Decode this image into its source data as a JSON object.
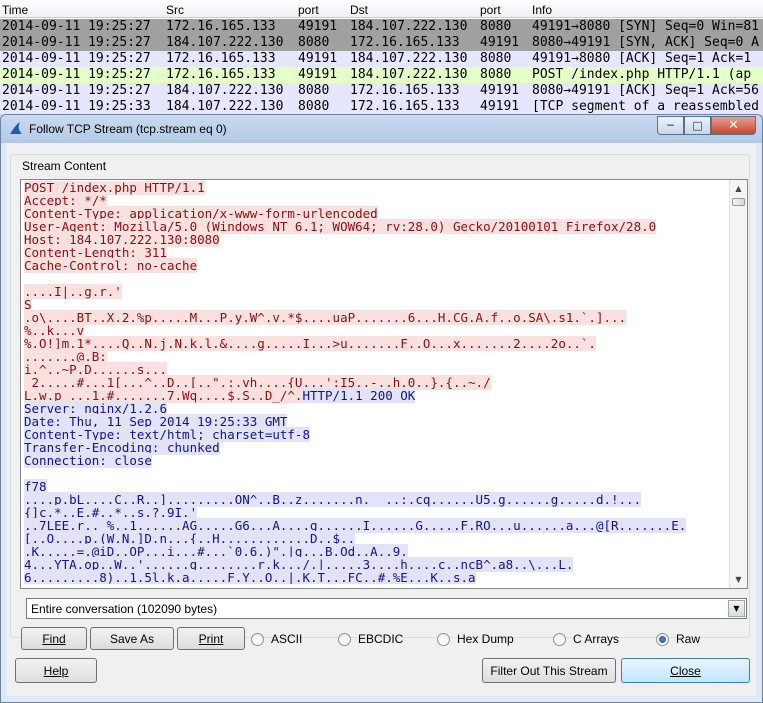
{
  "packet_list": {
    "columns": [
      "Time",
      "Src",
      "port",
      "Dst",
      "port",
      "Info"
    ],
    "rows": [
      [
        "2014-09-11 19:25:27",
        "172.16.165.133",
        "49191",
        "184.107.222.130",
        "8080",
        "49191→8080 [SYN] Seq=0 Win=81"
      ],
      [
        "2014-09-11 19:25:27",
        "184.107.222.130",
        "8080",
        "172.16.165.133",
        "49191",
        "8080→49191 [SYN, ACK] Seq=0 A"
      ],
      [
        "2014-09-11 19:25:27",
        "172.16.165.133",
        "49191",
        "184.107.222.130",
        "8080",
        "49191→8080 [ACK] Seq=1 Ack=1"
      ],
      [
        "2014-09-11 19:25:27",
        "172.16.165.133",
        "49191",
        "184.107.222.130",
        "8080",
        "POST /index.php HTTP/1.1  (ap"
      ],
      [
        "2014-09-11 19:25:27",
        "184.107.222.130",
        "8080",
        "172.16.165.133",
        "49191",
        "8080→49191 [ACK] Seq=1 Ack=56"
      ],
      [
        "2014-09-11 19:25:33",
        "184.107.222.130",
        "8080",
        "172.16.165.133",
        "49191",
        "[TCP segment of a reassembled"
      ]
    ],
    "row_colors": [
      "#a0a0a0",
      "#a0a0a0",
      "#e7e6ff",
      "#e4ffc7",
      "#e7e6ff",
      "#e7e6ff"
    ]
  },
  "dialog": {
    "title": "Follow TCP Stream (tcp.stream eq 0)",
    "title_icon": "shark-fin-icon",
    "window_buttons": {
      "minimize": "─",
      "maximize": "□",
      "close": "✕"
    },
    "group_label": "Stream Content",
    "stream_lines": [
      {
        "t": "POST /index.php HTTP/1.1",
        "s": "c"
      },
      {
        "t": "Accept: */*",
        "s": "c"
      },
      {
        "t": "Content-Type: application/x-www-form-urlencoded",
        "s": "c"
      },
      {
        "t": "User-Agent: Mozilla/5.0 (Windows NT 6.1; WOW64; rv:28.0) Gecko/20100101 Firefox/28.0",
        "s": "c"
      },
      {
        "t": "Host: 184.107.222.130:8080",
        "s": "c"
      },
      {
        "t": "Content-Length: 311",
        "s": "c"
      },
      {
        "t": "Cache-Control: no-cache",
        "s": "c"
      },
      {
        "t": "",
        "s": "c"
      },
      {
        "t": "....I|..g.r.'",
        "s": "c"
      },
      {
        "t": "S",
        "s": "c"
      },
      {
        "t": ".o\\....BT..X.2.%p.....M...P.y.W^.v.*$....uaP.......6...H.CG.A.f..o.SA\\.s1.`.]...",
        "s": "c"
      },
      {
        "t": "%..k...v",
        "s": "c"
      },
      {
        "t": "%.O!]m.1*....Q..N.j.N.k.l.&....g.....I...>u.......F..O...x.......2....2o..`.",
        "s": "c"
      },
      {
        "t": ".......@.B:",
        "s": "c"
      },
      {
        "t": "i.^..~P.D......s...",
        "s": "c"
      },
      {
        "t": " 2.....#...1[...^..D..[..\".:.vh....{U...':I5..-..h.0..}.{..~./",
        "s": "c"
      },
      {
        "t": "L.w.p ...1.#.......7.Wq....$.S..D_/^.",
        "s": "c",
        "tail": "HTTP/1.1 200 OK"
      },
      {
        "t": "Server: nginx/1.2.6",
        "s": "s"
      },
      {
        "t": "Date: Thu, 11 Sep 2014 19:25:33 GMT",
        "s": "s"
      },
      {
        "t": "Content-Type: text/html; charset=utf-8",
        "s": "s"
      },
      {
        "t": "Transfer-Encoding: chunked",
        "s": "s"
      },
      {
        "t": "Connection: close",
        "s": "s"
      },
      {
        "t": "",
        "s": "s"
      },
      {
        "t": "f78",
        "s": "s"
      },
      {
        "t": "....p.bL....C..R..].........ON^..B..z.......n.  ..:.cq......U5.g......g.....d.!...",
        "s": "s"
      },
      {
        "t": "{]c.*..E.#..*..s.?.9I.'",
        "s": "s"
      },
      {
        "t": "..7LEE.r.._%..1......AG.....G6...A....g......I......G.....F.RO...u......a...@[R.......E.",
        "s": "s"
      },
      {
        "t": "[..O....p.(W.N.]D.n...{..H............D..$..",
        "s": "s"
      },
      {
        "t": ".K.....=.@iD..OP...i...#...`0.6.)\".|g...B.Od..A..9.",
        "s": "s"
      },
      {
        "t": "4...YTA.op..W..'......g........r.k.../.|.....3....h....c..ncB^.a8..\\...L.",
        "s": "s"
      },
      {
        "t": "6.........8)..1.5l.k.a.....F.Y..O..|.K.T...FC..#.%E...K..s.a",
        "s": "s"
      }
    ],
    "combo_value": "Entire conversation (102090 bytes)",
    "buttons": {
      "find": "Find",
      "save_as": "Save As",
      "print": "Print",
      "help": "Help",
      "filter_out": "Filter Out This Stream",
      "close": "Close"
    },
    "radios": [
      {
        "label": "ASCII",
        "selected": false
      },
      {
        "label": "EBCDIC",
        "selected": false
      },
      {
        "label": "Hex Dump",
        "selected": false
      },
      {
        "label": "C Arrays",
        "selected": false
      },
      {
        "label": "Raw",
        "selected": true
      }
    ],
    "colors": {
      "client_text": "#8b1010",
      "client_bg": "#fbe0e0",
      "server_text": "#13138c",
      "server_bg": "#e2e2f8"
    }
  }
}
